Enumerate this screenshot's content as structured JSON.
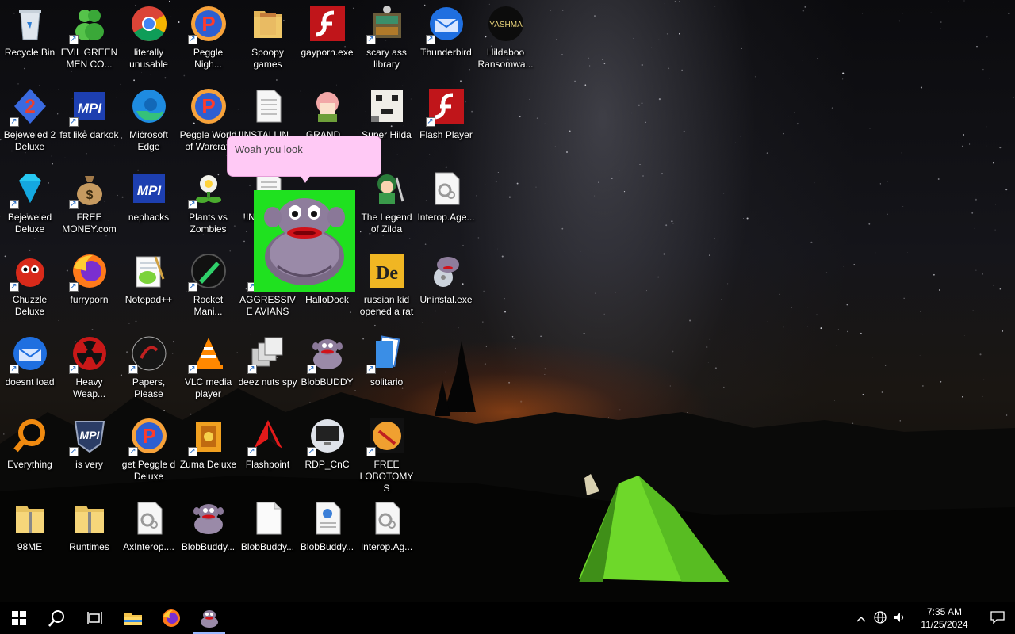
{
  "desktop": {
    "icons": [
      {
        "label": "Recycle Bin",
        "icon": "recycle-bin-icon",
        "shortcut": false
      },
      {
        "label": "EVIL GREEN MEN CO...",
        "icon": "green-men-icon",
        "shortcut": true
      },
      {
        "label": "literally unusable",
        "icon": "chrome-icon",
        "shortcut": false
      },
      {
        "label": "Peggle Nigh...",
        "icon": "peggle-icon",
        "shortcut": true
      },
      {
        "label": "Spoopy games",
        "icon": "folder-icon",
        "shortcut": false
      },
      {
        "label": "gayporn.exe",
        "icon": "flash-icon",
        "shortcut": false
      },
      {
        "label": "scary ass library",
        "icon": "library-icon",
        "shortcut": true
      },
      {
        "label": "Thunderbird",
        "icon": "thunderbird-icon",
        "shortcut": true
      },
      {
        "label": "Hildaboo Ransomwa...",
        "icon": "yashma-icon",
        "shortcut": false
      },
      {
        "label": "Bejeweled 2 Deluxe",
        "icon": "bejeweled2-icon",
        "shortcut": true
      },
      {
        "label": "fat like darkok",
        "icon": "mpi-icon",
        "shortcut": true
      },
      {
        "label": "Microsoft Edge",
        "icon": "edge-icon",
        "shortcut": false
      },
      {
        "label": "Peggle World of Warcraft",
        "icon": "peggle-icon",
        "shortcut": false
      },
      {
        "label": "!INSTALLIN...",
        "icon": "text-file-icon",
        "shortcut": false
      },
      {
        "label": "GRAND...",
        "icon": "anime-girl-icon",
        "shortcut": false
      },
      {
        "label": "Super Hilda",
        "icon": "pixel-cat-icon",
        "shortcut": false
      },
      {
        "label": "Flash Player",
        "icon": "flash-icon",
        "shortcut": true
      },
      {
        "label": "Bejeweled Deluxe",
        "icon": "gem-icon",
        "shortcut": true
      },
      {
        "label": "FREE MONEY.com",
        "icon": "money-bag-icon",
        "shortcut": true
      },
      {
        "label": "nephacks",
        "icon": "mpi-icon",
        "shortcut": false
      },
      {
        "label": "Plants vs Zombies",
        "icon": "plant-icon",
        "shortcut": true
      },
      {
        "label": "!INS... - S...",
        "icon": "text-file-icon",
        "shortcut": false
      },
      {
        "label": "The Legend of Zilda",
        "icon": "zelda-icon",
        "shortcut": false
      },
      {
        "label": "Interop.Age...",
        "icon": "dll-icon",
        "shortcut": false
      },
      {
        "label": "Chuzzle Deluxe",
        "icon": "chuzzle-icon",
        "shortcut": true
      },
      {
        "label": "furryporn",
        "icon": "firefox-icon",
        "shortcut": true
      },
      {
        "label": "Notepad++",
        "icon": "notepad-icon",
        "shortcut": false
      },
      {
        "label": "Rocket Mani...",
        "icon": "rocket-icon",
        "shortcut": true
      },
      {
        "label": "AGGRESSIVE AVIANS",
        "icon": "bird-icon",
        "shortcut": true
      },
      {
        "label": "HalloDock",
        "icon": "hallodock-icon",
        "shortcut": false
      },
      {
        "label": "russian kid opened a rat",
        "icon": "de-icon",
        "shortcut": false
      },
      {
        "label": "Uninstal.exe",
        "icon": "uninstall-icon",
        "shortcut": false
      },
      {
        "label": "doesnt load",
        "icon": "thunderbird-icon",
        "shortcut": true
      },
      {
        "label": "Heavy Weap...",
        "icon": "radiation-icon",
        "shortcut": true
      },
      {
        "label": "Papers, Please",
        "icon": "papers-icon",
        "shortcut": true
      },
      {
        "label": "VLC media player",
        "icon": "vlc-icon",
        "shortcut": true
      },
      {
        "label": "deez nuts spy",
        "icon": "windows-stack-icon",
        "shortcut": true
      },
      {
        "label": "BlobBUDDY",
        "icon": "blob-icon",
        "shortcut": true
      },
      {
        "label": "solitario",
        "icon": "cards-icon",
        "shortcut": true
      },
      {
        "label": "Everything",
        "icon": "magnifier-icon",
        "shortcut": false
      },
      {
        "label": "is very",
        "icon": "mpi-shield-icon",
        "shortcut": true
      },
      {
        "label": "get Peggle d Deluxe",
        "icon": "peggle-icon",
        "shortcut": true
      },
      {
        "label": "Zuma Deluxe",
        "icon": "zuma-icon",
        "shortcut": true
      },
      {
        "label": "Flashpoint",
        "icon": "flashpoint-icon",
        "shortcut": true
      },
      {
        "label": "RDP_CnC",
        "icon": "rdp-icon",
        "shortcut": true
      },
      {
        "label": "FREE LOBOTOMYS",
        "icon": "lobotomy-icon",
        "shortcut": true
      },
      {
        "label": "98ME",
        "icon": "zip-folder-icon",
        "shortcut": false
      },
      {
        "label": "Runtimes",
        "icon": "zip-folder-icon",
        "shortcut": false
      },
      {
        "label": "AxInterop....",
        "icon": "dll-icon",
        "shortcut": false
      },
      {
        "label": "BlobBuddy...",
        "icon": "blob-icon",
        "shortcut": false
      },
      {
        "label": "BlobBuddy...",
        "icon": "blank-file-icon",
        "shortcut": false
      },
      {
        "label": "BlobBuddy...",
        "icon": "config-file-icon",
        "shortcut": false
      },
      {
        "label": "Interop.Ag...",
        "icon": "dll-icon",
        "shortcut": false
      }
    ]
  },
  "buddy": {
    "speech": "Woah you look",
    "name": "BlobBUDDY character"
  },
  "taskbar": {
    "start": "start-icon",
    "search": "search-icon",
    "task_view": "task-view-icon",
    "apps": [
      "file-explorer-icon",
      "firefox-icon",
      "blob-icon"
    ],
    "tray": {
      "time": "7:35 AM",
      "date": "11/25/2024"
    }
  }
}
